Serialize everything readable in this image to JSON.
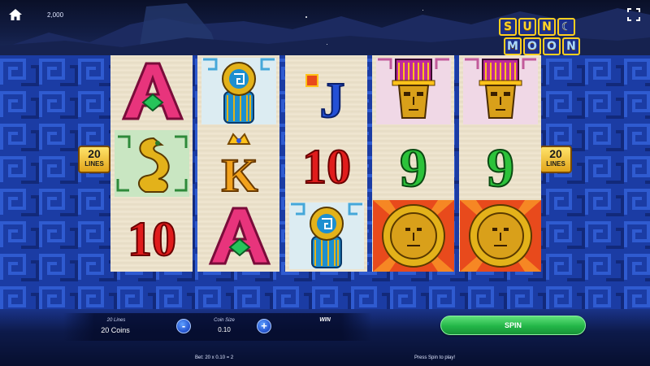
{
  "topbar": {
    "home_icon": "home-icon",
    "balance": "2,000",
    "fullscreen_icon": "fullscreen-icon"
  },
  "logo": {
    "line1": [
      "S",
      "U",
      "N"
    ],
    "line2": [
      "M",
      "O",
      "O",
      "N"
    ]
  },
  "reels": [
    [
      "A",
      "mayan-snake",
      "10"
    ],
    [
      "mayan-shield",
      "K",
      "A"
    ],
    [
      "J",
      "10",
      "mayan-shield"
    ],
    [
      "mayan-mask",
      "9",
      "sun-disc"
    ],
    [
      "mayan-mask",
      "9",
      "sun-disc"
    ]
  ],
  "paylines_badge": {
    "count": "20",
    "label": "LINES"
  },
  "controls": {
    "lines_label": "20 Lines",
    "coins_value": "20 Coins",
    "minus_label": "-",
    "coin_size_label": "Coin Size",
    "coin_size_value": "0.10",
    "plus_label": "+",
    "win_label": "WIN",
    "spin_label": "SPIN",
    "bet_text": "Bet: 20 x 0.10 = 2",
    "status_text": "Press Spin to play!"
  },
  "colors": {
    "background_blue": "#1a3a9e",
    "reel_paper": "#f1e8d4",
    "spin_green": "#23b648",
    "gold": "#ffd52a"
  }
}
